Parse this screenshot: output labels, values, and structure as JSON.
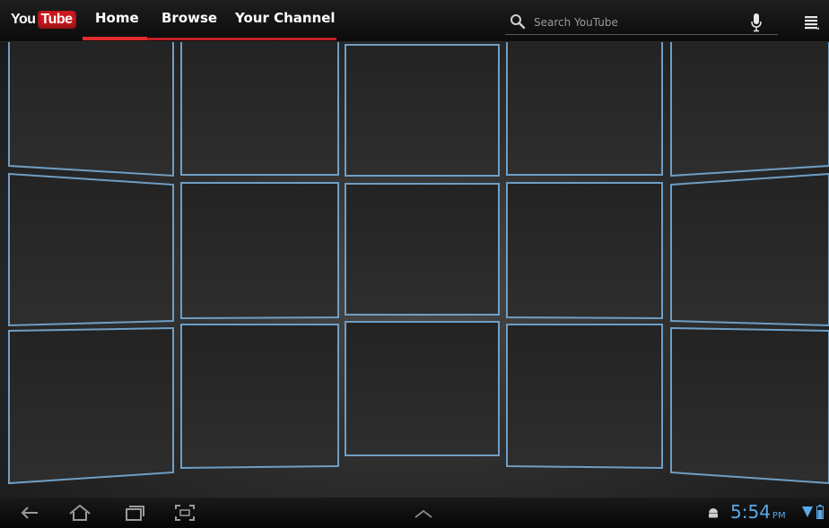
{
  "app": {
    "logo_you": "You",
    "logo_tube": "Tube",
    "brand_color": "#cc181e"
  },
  "tabs": [
    {
      "label": "Home",
      "selected": true
    },
    {
      "label": "Browse",
      "selected": false
    },
    {
      "label": "Your Channel",
      "selected": false
    }
  ],
  "search": {
    "placeholder": "Search YouTube",
    "icon": "magnifier-icon"
  },
  "toolbar": {
    "voice_icon": "microphone-icon",
    "menu_icon": "overflow-menu-icon"
  },
  "video_wall": {
    "rows": 3,
    "columns": 5,
    "tile_border_color": "#6f9ec4"
  },
  "system_bar": {
    "back_icon": "back-arrow-icon",
    "home_icon": "home-icon",
    "recents_icon": "recent-apps-icon",
    "screenshot_icon": "screenshot-icon",
    "apps_icon": "chevron-up-icon",
    "time": "5:54",
    "ampm": "PM",
    "accent_color": "#5aa9e6"
  }
}
